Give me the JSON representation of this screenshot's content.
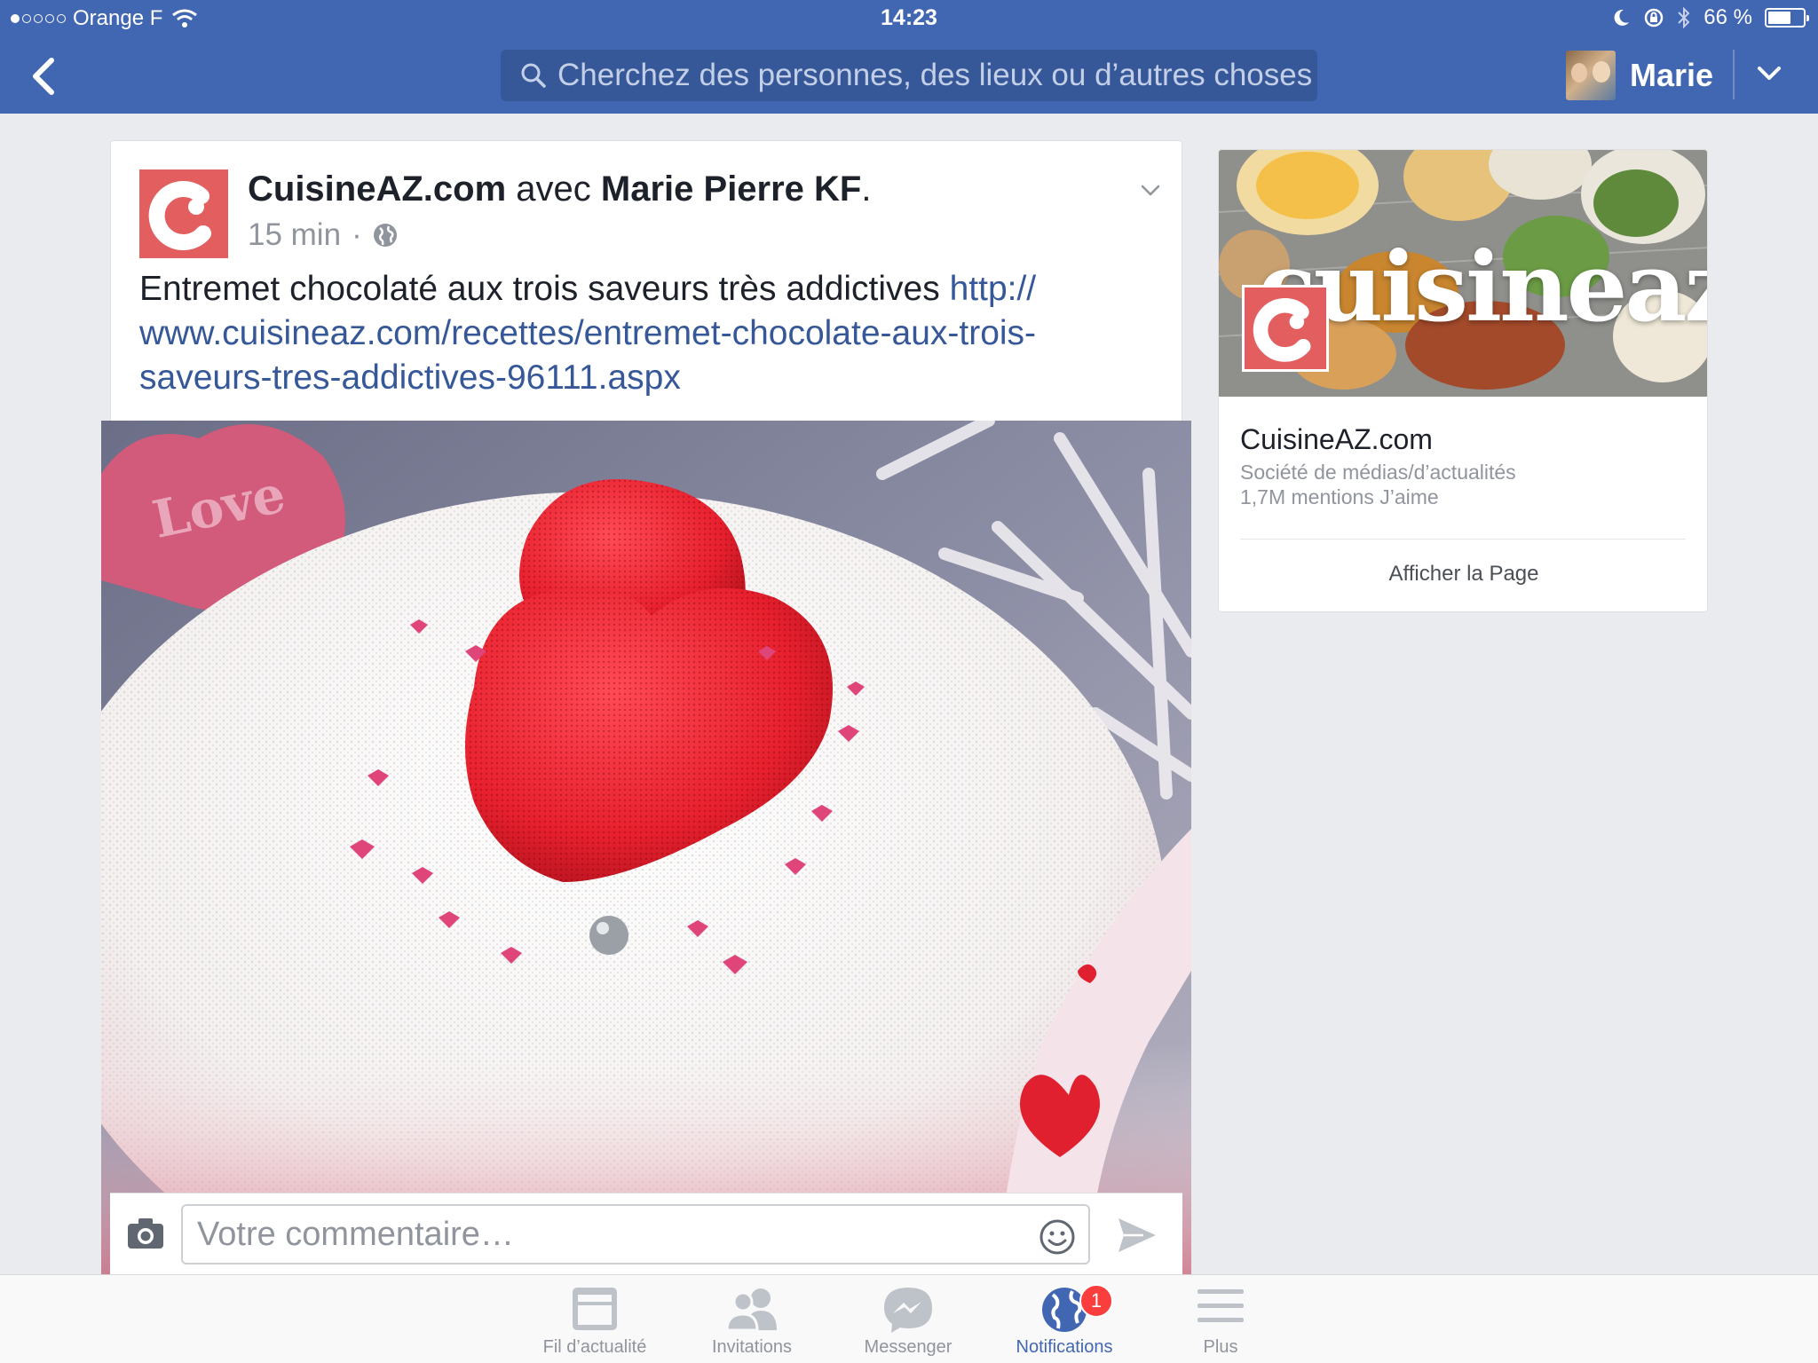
{
  "status_bar": {
    "carrier": "Orange F",
    "signal_dots_filled": 1,
    "signal_dots_total": 5,
    "time": "14:23",
    "battery": "66 %",
    "battery_level": 0.66
  },
  "navbar": {
    "search_placeholder": "Cherchez des personnes, des lieux ou d’autres choses",
    "user_name": "Marie",
    "bar_color": "#4267b2"
  },
  "post": {
    "page_name": "CuisineAZ.com",
    "with_word": "avec",
    "tagged_name": "Marie Pierre KF",
    "period": ".",
    "time": "15 min",
    "separator": "·",
    "privacy_icon": "globe-icon",
    "text": "Entremet chocolaté aux trois saveurs très addictives ",
    "link_line1": "http://",
    "link_line2": "www.cuisineaz.com/recettes/entremet-chocolate-aux-trois-",
    "link_line3": "saveurs-tres-addictives-96111.aspx",
    "photo_text": "Love"
  },
  "comment": {
    "placeholder": "Votre commentaire…"
  },
  "page_card": {
    "cover_word": "cuisineaz",
    "title": "CuisineAZ.com",
    "category": "Société de médias/d’actualités",
    "likes": "1,7M mentions J’aime",
    "button": "Afficher la Page"
  },
  "tabbar": {
    "tabs": [
      {
        "label": "Fil d’actualité",
        "icon": "news-feed-icon"
      },
      {
        "label": "Invitations",
        "icon": "friends-icon"
      },
      {
        "label": "Messenger",
        "icon": "messenger-icon"
      },
      {
        "label": "Notifications",
        "icon": "globe-icon",
        "badge": "1"
      },
      {
        "label": "Plus",
        "icon": "menu-icon"
      }
    ],
    "active_color": "#4267b2"
  },
  "brand_color": "#e35f5f"
}
